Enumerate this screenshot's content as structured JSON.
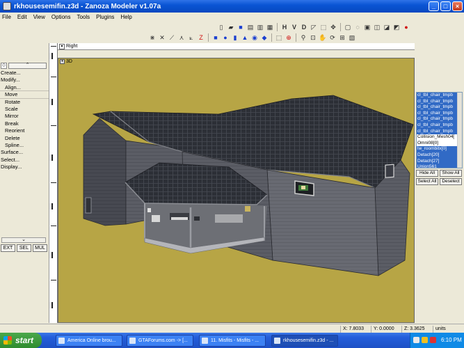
{
  "window": {
    "title": "rkhousesemifin.z3d - Zanoza Modeler v1.07a"
  },
  "menubar": [
    "File",
    "Edit",
    "View",
    "Options",
    "Tools",
    "Plugins",
    "Help"
  ],
  "toolbar": {
    "h": "H",
    "v": "V",
    "d": "D",
    "z": "Z"
  },
  "left_panel": {
    "items": [
      {
        "label": "Create...",
        "sub": false
      },
      {
        "label": "Modify...",
        "sub": false
      },
      {
        "label": "Align...",
        "sub": true
      },
      {
        "label": "Move",
        "sub": true
      },
      {
        "label": "Rotate",
        "sub": true
      },
      {
        "label": "Scale",
        "sub": true
      },
      {
        "label": "Mirror",
        "sub": true
      },
      {
        "label": "Break",
        "sub": true
      },
      {
        "label": "Reorient",
        "sub": true
      },
      {
        "label": "Delete",
        "sub": true
      },
      {
        "label": "Spline...",
        "sub": true
      },
      {
        "label": "Surface...",
        "sub": false
      },
      {
        "label": "Select...",
        "sub": false
      },
      {
        "label": "Display...",
        "sub": false
      }
    ],
    "bottom_buttons": [
      "EXT",
      "SEL",
      "MUL"
    ]
  },
  "viewports": {
    "right_label": "Right",
    "perspective_label": "3D"
  },
  "right_panel": {
    "objects": [
      {
        "label": "cl_tbl_chair_tmpb",
        "selected": true
      },
      {
        "label": "cl_tbl_chair_tmpb",
        "selected": true
      },
      {
        "label": "cl_tbl_chair_tmpb",
        "selected": true
      },
      {
        "label": "cl_tbl_chair_tmpb",
        "selected": true
      },
      {
        "label": "cl_tbl_chair_tmpb",
        "selected": true
      },
      {
        "label": "cl_tbl_chair_tmpb",
        "selected": true
      },
      {
        "label": "cl_tbl_chair_tmpb",
        "selected": true
      },
      {
        "label": "Collision_Mesh04[",
        "selected": false
      },
      {
        "label": "Omni08[0]",
        "selected": false
      },
      {
        "label": "lw_roombitx[0]",
        "selected": true
      },
      {
        "label": "Detach[20]",
        "selected": true
      },
      {
        "label": "Detach[27]",
        "selected": true
      },
      {
        "label": "Union561",
        "selected": true
      }
    ],
    "hide_all": "Hide All",
    "show_all": "Show All",
    "select_all": "Select All",
    "deselect": "Deselect"
  },
  "status": {
    "x": "X: 7.8033",
    "y": "Y: 0.0000",
    "z": "Z: 3.3625",
    "units": "units"
  },
  "taskbar": {
    "start": "start",
    "tasks": [
      {
        "label": "America Online brou...",
        "active": false
      },
      {
        "label": "GTAForums.com -> [...",
        "active": false
      },
      {
        "label": "11. Misfits - Misfits - ...",
        "active": false
      },
      {
        "label": "rkhousesemifin.z3d - ...",
        "active": true
      }
    ],
    "clock": "6:10 PM"
  },
  "colors": {
    "viewport_bg": "#b7a545",
    "selection": "#316ac5",
    "taskbar": "#245edb"
  }
}
